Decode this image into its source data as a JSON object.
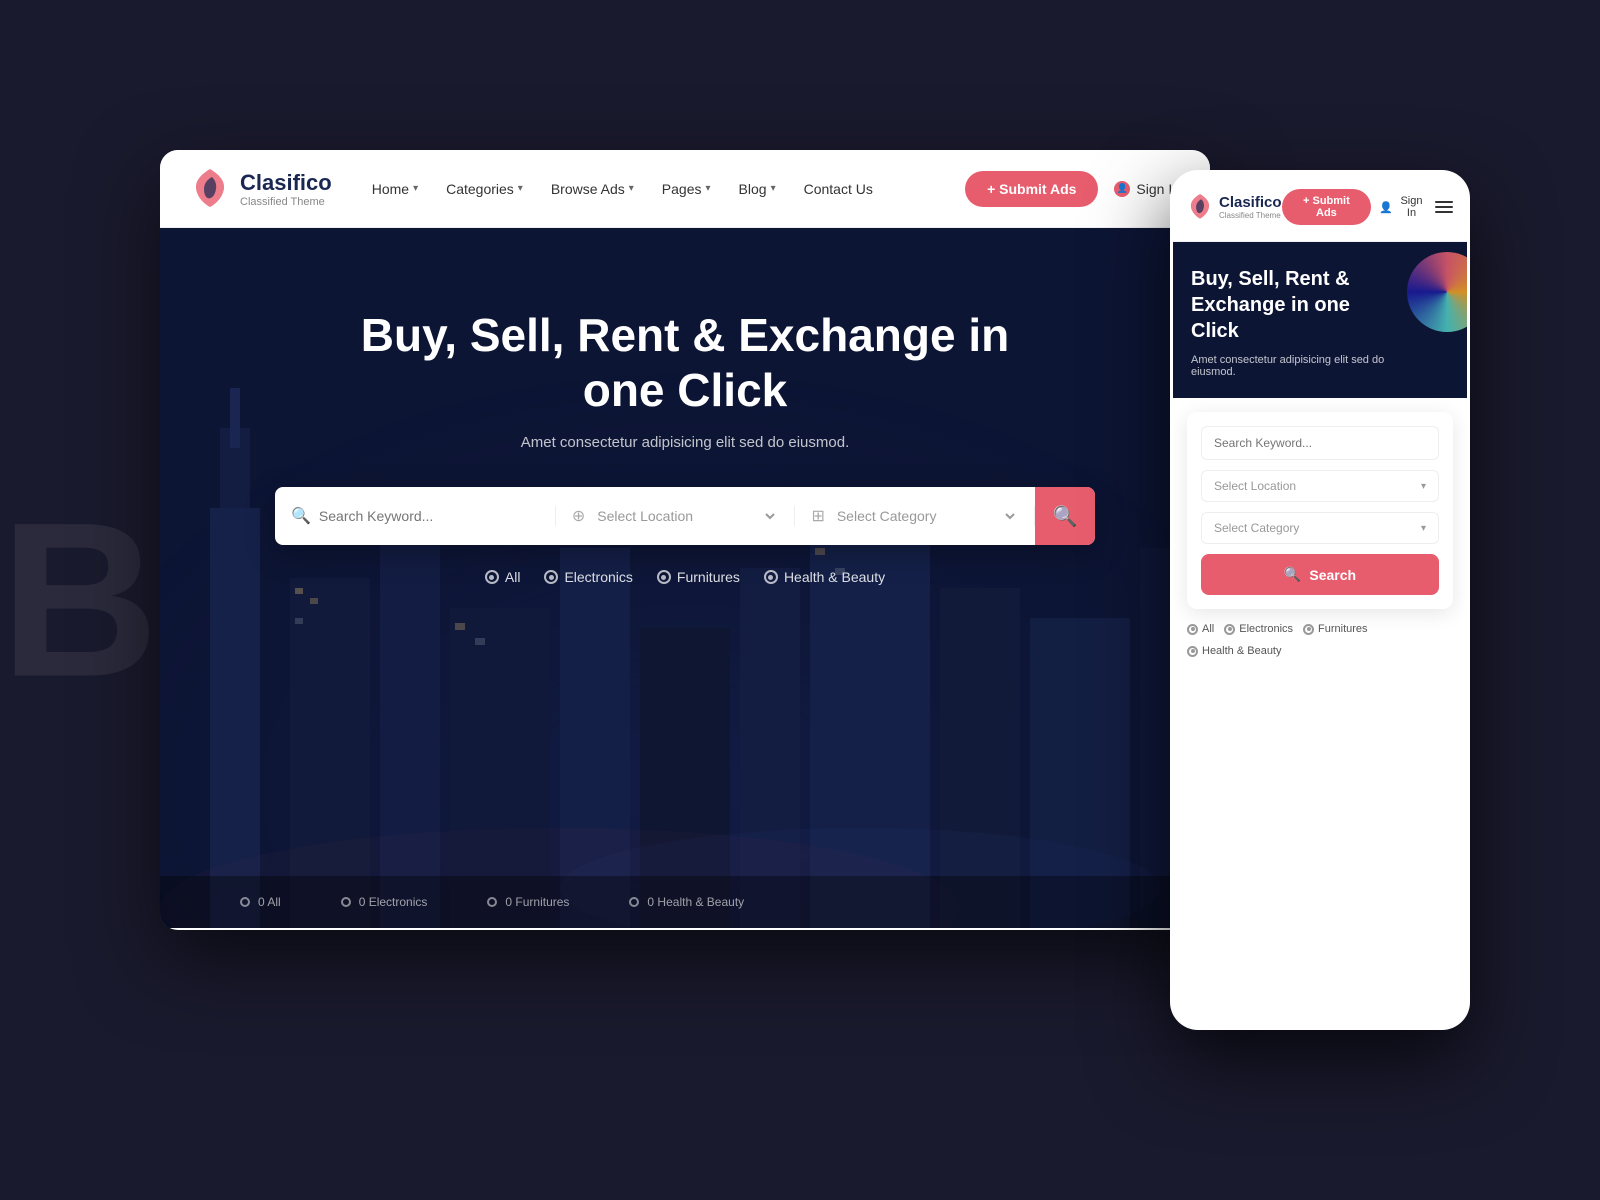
{
  "background": {
    "text": "Bu"
  },
  "desktop": {
    "navbar": {
      "logo_title": "Clasifico",
      "logo_subtitle": "Classified Theme",
      "nav_items": [
        {
          "label": "Home",
          "has_dropdown": true
        },
        {
          "label": "Categories",
          "has_dropdown": true
        },
        {
          "label": "Browse Ads",
          "has_dropdown": true
        },
        {
          "label": "Pages",
          "has_dropdown": true
        },
        {
          "label": "Blog",
          "has_dropdown": true
        },
        {
          "label": "Contact Us",
          "has_dropdown": false
        }
      ],
      "submit_btn": "+ Submit Ads",
      "signin_btn": "Sign In"
    },
    "hero": {
      "title": "Buy, Sell, Rent & Exchange in one Click",
      "subtitle": "Amet consectetur adipisicing elit sed do eiusmod.",
      "search_placeholder": "Search Keyword...",
      "location_placeholder": "Select Location",
      "category_placeholder": "Select Category",
      "filters": [
        "All",
        "Electronics",
        "Furnitures",
        "Health & Beauty"
      ]
    }
  },
  "mobile": {
    "navbar": {
      "logo_title": "Clasifico",
      "logo_subtitle": "Classified Theme",
      "submit_btn": "+ Submit Ads",
      "signin_btn": "Sign In"
    },
    "hero": {
      "title": "Buy, Sell, Rent & Exchange in one Click",
      "subtitle": "Amet consectetur adipisicing elit sed do eiusmod."
    },
    "search": {
      "keyword_placeholder": "Search Keyword...",
      "location_placeholder": "Select Location",
      "category_placeholder": "Select Category",
      "search_btn": "Search"
    },
    "filters": [
      "All",
      "Electronics",
      "Furnitures",
      "Health & Beauty"
    ]
  }
}
